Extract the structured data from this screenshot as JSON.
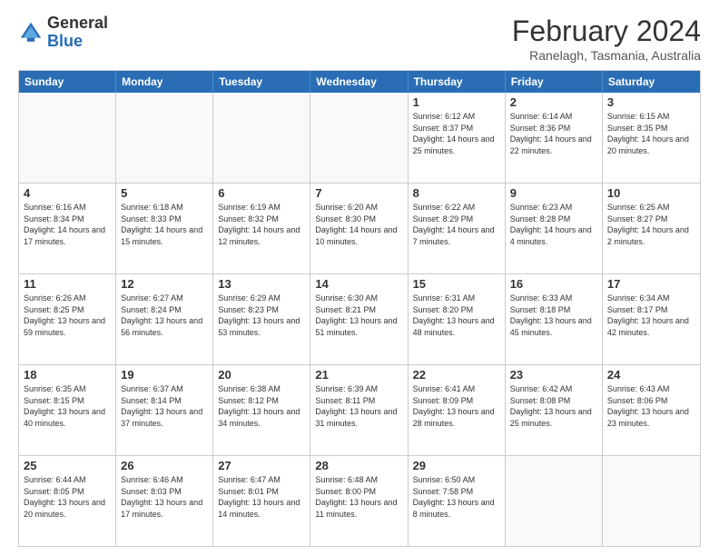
{
  "header": {
    "logo_general": "General",
    "logo_blue": "Blue",
    "month_title": "February 2024",
    "location": "Ranelagh, Tasmania, Australia"
  },
  "days_of_week": [
    "Sunday",
    "Monday",
    "Tuesday",
    "Wednesday",
    "Thursday",
    "Friday",
    "Saturday"
  ],
  "weeks": [
    [
      {
        "day": "",
        "info": ""
      },
      {
        "day": "",
        "info": ""
      },
      {
        "day": "",
        "info": ""
      },
      {
        "day": "",
        "info": ""
      },
      {
        "day": "1",
        "info": "Sunrise: 6:12 AM\nSunset: 8:37 PM\nDaylight: 14 hours and 25 minutes."
      },
      {
        "day": "2",
        "info": "Sunrise: 6:14 AM\nSunset: 8:36 PM\nDaylight: 14 hours and 22 minutes."
      },
      {
        "day": "3",
        "info": "Sunrise: 6:15 AM\nSunset: 8:35 PM\nDaylight: 14 hours and 20 minutes."
      }
    ],
    [
      {
        "day": "4",
        "info": "Sunrise: 6:16 AM\nSunset: 8:34 PM\nDaylight: 14 hours and 17 minutes."
      },
      {
        "day": "5",
        "info": "Sunrise: 6:18 AM\nSunset: 8:33 PM\nDaylight: 14 hours and 15 minutes."
      },
      {
        "day": "6",
        "info": "Sunrise: 6:19 AM\nSunset: 8:32 PM\nDaylight: 14 hours and 12 minutes."
      },
      {
        "day": "7",
        "info": "Sunrise: 6:20 AM\nSunset: 8:30 PM\nDaylight: 14 hours and 10 minutes."
      },
      {
        "day": "8",
        "info": "Sunrise: 6:22 AM\nSunset: 8:29 PM\nDaylight: 14 hours and 7 minutes."
      },
      {
        "day": "9",
        "info": "Sunrise: 6:23 AM\nSunset: 8:28 PM\nDaylight: 14 hours and 4 minutes."
      },
      {
        "day": "10",
        "info": "Sunrise: 6:25 AM\nSunset: 8:27 PM\nDaylight: 14 hours and 2 minutes."
      }
    ],
    [
      {
        "day": "11",
        "info": "Sunrise: 6:26 AM\nSunset: 8:25 PM\nDaylight: 13 hours and 59 minutes."
      },
      {
        "day": "12",
        "info": "Sunrise: 6:27 AM\nSunset: 8:24 PM\nDaylight: 13 hours and 56 minutes."
      },
      {
        "day": "13",
        "info": "Sunrise: 6:29 AM\nSunset: 8:23 PM\nDaylight: 13 hours and 53 minutes."
      },
      {
        "day": "14",
        "info": "Sunrise: 6:30 AM\nSunset: 8:21 PM\nDaylight: 13 hours and 51 minutes."
      },
      {
        "day": "15",
        "info": "Sunrise: 6:31 AM\nSunset: 8:20 PM\nDaylight: 13 hours and 48 minutes."
      },
      {
        "day": "16",
        "info": "Sunrise: 6:33 AM\nSunset: 8:18 PM\nDaylight: 13 hours and 45 minutes."
      },
      {
        "day": "17",
        "info": "Sunrise: 6:34 AM\nSunset: 8:17 PM\nDaylight: 13 hours and 42 minutes."
      }
    ],
    [
      {
        "day": "18",
        "info": "Sunrise: 6:35 AM\nSunset: 8:15 PM\nDaylight: 13 hours and 40 minutes."
      },
      {
        "day": "19",
        "info": "Sunrise: 6:37 AM\nSunset: 8:14 PM\nDaylight: 13 hours and 37 minutes."
      },
      {
        "day": "20",
        "info": "Sunrise: 6:38 AM\nSunset: 8:12 PM\nDaylight: 13 hours and 34 minutes."
      },
      {
        "day": "21",
        "info": "Sunrise: 6:39 AM\nSunset: 8:11 PM\nDaylight: 13 hours and 31 minutes."
      },
      {
        "day": "22",
        "info": "Sunrise: 6:41 AM\nSunset: 8:09 PM\nDaylight: 13 hours and 28 minutes."
      },
      {
        "day": "23",
        "info": "Sunrise: 6:42 AM\nSunset: 8:08 PM\nDaylight: 13 hours and 25 minutes."
      },
      {
        "day": "24",
        "info": "Sunrise: 6:43 AM\nSunset: 8:06 PM\nDaylight: 13 hours and 23 minutes."
      }
    ],
    [
      {
        "day": "25",
        "info": "Sunrise: 6:44 AM\nSunset: 8:05 PM\nDaylight: 13 hours and 20 minutes."
      },
      {
        "day": "26",
        "info": "Sunrise: 6:46 AM\nSunset: 8:03 PM\nDaylight: 13 hours and 17 minutes."
      },
      {
        "day": "27",
        "info": "Sunrise: 6:47 AM\nSunset: 8:01 PM\nDaylight: 13 hours and 14 minutes."
      },
      {
        "day": "28",
        "info": "Sunrise: 6:48 AM\nSunset: 8:00 PM\nDaylight: 13 hours and 11 minutes."
      },
      {
        "day": "29",
        "info": "Sunrise: 6:50 AM\nSunset: 7:58 PM\nDaylight: 13 hours and 8 minutes."
      },
      {
        "day": "",
        "info": ""
      },
      {
        "day": "",
        "info": ""
      }
    ]
  ]
}
